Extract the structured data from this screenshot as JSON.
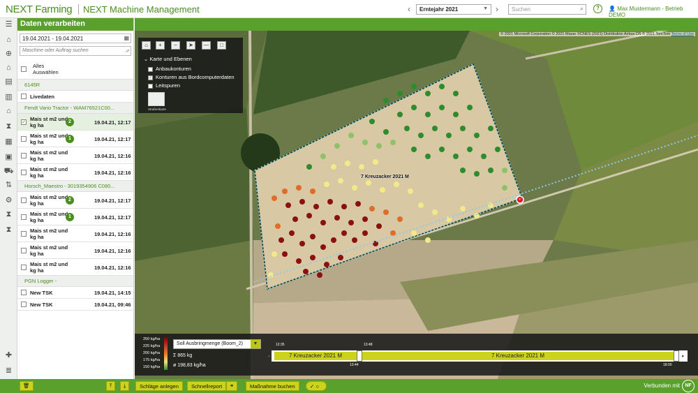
{
  "header": {
    "brand": "NEXT Farming",
    "app_title": "NEXT Machine Management",
    "year": "Erntejahr 2021",
    "search_placeholder": "Suchen",
    "help": "?",
    "user": "Max Mustermann - Betrieb DEMO"
  },
  "panel": {
    "title": "Daten verarbeiten",
    "date_range": "19.04.2021 - 19.04.2021",
    "machine_search_placeholder": "Maschine oder Auftrag suchen",
    "select_all": "Alles Auswählen",
    "groups": [
      {
        "name": "6145R",
        "rows": [
          {
            "label": "Livedaten",
            "date": "",
            "badge": ""
          }
        ]
      },
      {
        "name": "Fendt Vario Tractor - WAM76521C00...",
        "rows": [
          {
            "label": "Mais st m2 und kg ha",
            "badge": "2",
            "date": "19.04.21, 12:17",
            "checked": true
          },
          {
            "label": "Mais st m2 und kg ha",
            "badge": "1",
            "date": "19.04.21, 12:17"
          },
          {
            "label": "Mais st m2 und kg ha",
            "badge": "",
            "date": "19.04.21, 12:16"
          },
          {
            "label": "Mais st m2 und kg ha",
            "badge": "",
            "date": "19.04.21, 12:16"
          }
        ]
      },
      {
        "name": "Horsch_Maestro - 3019354906 C080...",
        "rows": [
          {
            "label": "Mais st m2 und kg ha",
            "badge": "2",
            "date": "19.04.21, 12:17"
          },
          {
            "label": "Mais st m2 und kg ha",
            "badge": "1",
            "date": "19.04.21, 12:17"
          },
          {
            "label": "Mais st m2 und kg ha",
            "badge": "",
            "date": "19.04.21, 12:16"
          },
          {
            "label": "Mais st m2 und kg ha",
            "badge": "",
            "date": "19.04.21, 12:16"
          },
          {
            "label": "Mais st m2 und kg ha",
            "badge": "",
            "date": "19.04.21, 12:16"
          }
        ]
      },
      {
        "name": "PGN Logger -",
        "rows": [
          {
            "label": "New TSK",
            "badge": "",
            "date": "19.04.21, 14:15"
          },
          {
            "label": "New TSK",
            "badge": "",
            "date": "19.04.21, 09:46"
          }
        ]
      }
    ]
  },
  "map": {
    "copyright": "© 2021 Microsoft Corporation © 2021 Maxar ©CNES (2021) Distribution Airbus DS © 2021 TomTom",
    "terms": "Terms of Use",
    "field_label": "7 Kreuzacker 2021 M",
    "layers": {
      "title": "Karte und Ebenen",
      "items": [
        {
          "label": "Anbaukonturen",
          "checked": false
        },
        {
          "label": "Konturen aus Bordcomputerdaten",
          "checked": true
        },
        {
          "label": "Leitspuren",
          "checked": false
        }
      ],
      "basemap_label": "Straßenkarte"
    },
    "legend": [
      "250 kg/ha",
      "225 kg/ha",
      "200 kg/ha",
      "175 kg/ha",
      "150 kg/ha"
    ],
    "dropdown": "Soll Ausbringmenge (Boom_2)",
    "sum": "Σ 865 kg",
    "avg": "ø 198,83 kg/ha",
    "timeline": {
      "seg1": "7 Kreuzacker 2021 M",
      "seg2": "7 Kreuzacker 2021 M",
      "t_start": "12:35",
      "t_mid_top": "13:48",
      "t_mid_bottom": "13:44",
      "t_end": "18:00"
    }
  },
  "footer": {
    "btn_schlaege": "Schläge anlegen",
    "btn_schnellreport": "Schnellreport",
    "btn_massnahme": "Maßnahme buchen",
    "connected": "Verbunden mit",
    "logo": "NF"
  }
}
